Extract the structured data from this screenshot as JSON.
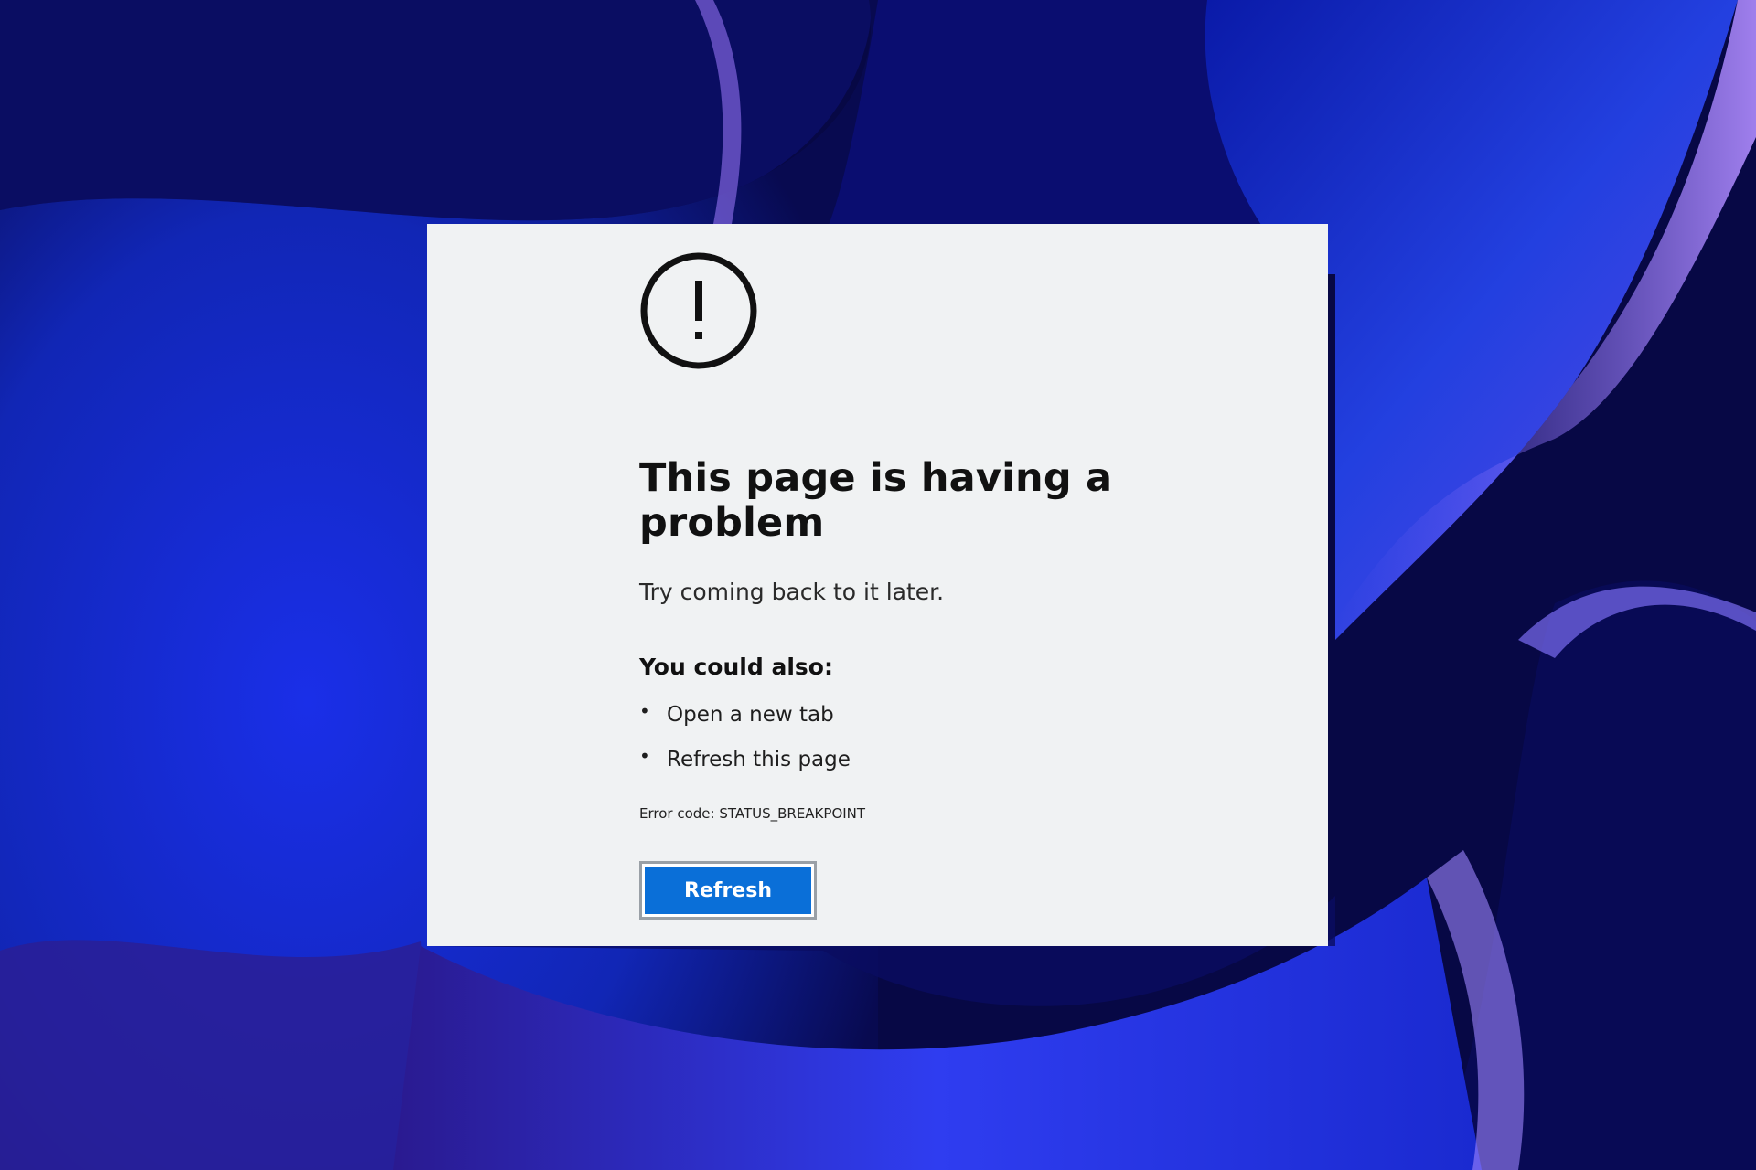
{
  "error_page": {
    "icon": "exclamation-circle-icon",
    "title": "This page is having a problem",
    "subtitle": "Try coming back to it later.",
    "also_heading": "You could also:",
    "suggestions": [
      {
        "label": "Open a new tab"
      },
      {
        "label": "Refresh this page"
      }
    ],
    "error_code": "Error code: STATUS_BREAKPOINT",
    "refresh_label": "Refresh"
  },
  "colors": {
    "panel_background": "#f0f2f3",
    "button_blue": "#0a6fd8",
    "wallpaper_dark": "#0a0a5a",
    "wallpaper_blue": "#1a2fe0",
    "wallpaper_purple": "#7a5cf0"
  }
}
